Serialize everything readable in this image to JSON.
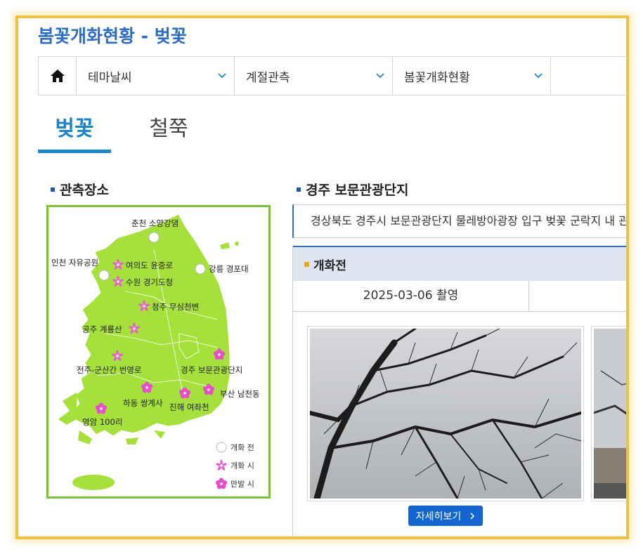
{
  "page": {
    "title": "봄꽃개화현황 - 벚꽃"
  },
  "navbar": {
    "home_icon": "home-icon",
    "items": [
      {
        "label": "테마날씨",
        "icon": "chevron-down-icon"
      },
      {
        "label": "계절관측",
        "icon": "chevron-down-icon"
      },
      {
        "label": "봄꽃개화현황",
        "icon": "chevron-down-icon"
      }
    ]
  },
  "tabs": [
    {
      "label": "벚꽃",
      "active": true
    },
    {
      "label": "철쭉",
      "active": false
    }
  ],
  "map_section": {
    "title": "관측장소",
    "locations": [
      {
        "name": "춘천 소양강댐",
        "status": "before"
      },
      {
        "name": "인천 자유공원",
        "status": "before"
      },
      {
        "name": "여의도 윤중로",
        "status": "blooming"
      },
      {
        "name": "강릉 경포대",
        "status": "before"
      },
      {
        "name": "수원 경기도청",
        "status": "blooming"
      },
      {
        "name": "청주 무심천변",
        "status": "blooming"
      },
      {
        "name": "공주 계룡산",
        "status": "blooming"
      },
      {
        "name": "전주-군산간 번영로",
        "status": "blooming"
      },
      {
        "name": "경주 보문관광단지",
        "status": "full"
      },
      {
        "name": "하동 쌍계사",
        "status": "full"
      },
      {
        "name": "부산 남천동",
        "status": "full"
      },
      {
        "name": "진해 여좌천",
        "status": "full"
      },
      {
        "name": "영암 100리",
        "status": "full"
      }
    ],
    "legend": [
      {
        "label": "개화 전",
        "status": "before"
      },
      {
        "label": "개화 시",
        "status": "blooming"
      },
      {
        "label": "만발 시",
        "status": "full"
      }
    ],
    "colors": {
      "land": "#a6e03a",
      "border": "#7cc13b",
      "flower_full": "#e64fc9",
      "flower_blooming": "#e85ed2"
    }
  },
  "detail_section": {
    "title": "경주 보문관광단지",
    "description": "경상북도 경주시 보문관광단지 물레방아광장 입구 벚꽃 군락지 내 관",
    "stage_label": "개화전",
    "date": "2025-03-06 촬영",
    "button_label": "자세히보기",
    "button_icon": "chevron-right-icon"
  }
}
